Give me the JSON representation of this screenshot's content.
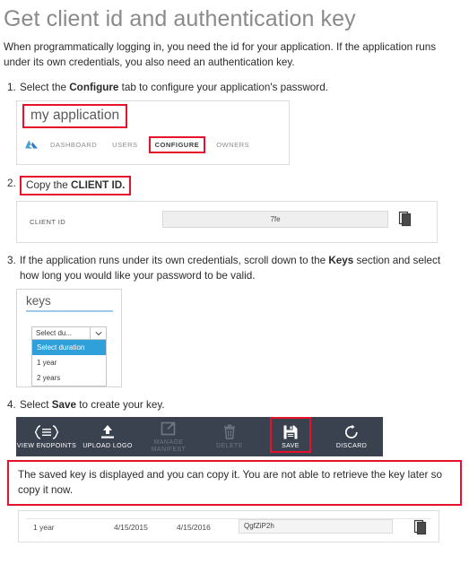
{
  "page": {
    "title": "Get client id and authentication key",
    "intro": "When programmatically logging in, you need the id for your application. If the application runs under its own credentials, you also need an authentication key."
  },
  "steps": [
    {
      "number": "1.",
      "text_before": "Select the ",
      "bold": "Configure",
      "text_after": " tab to configure your application's password."
    },
    {
      "number": "2.",
      "text_before": "Copy the ",
      "bold": "CLIENT ID.",
      "text_after": ""
    },
    {
      "number": "3.",
      "text_before": "If the application runs under its own credentials, scroll down to the ",
      "bold": "Keys",
      "text_after": " section and select how long you would like your password to be valid."
    },
    {
      "number": "4.",
      "text_before": "Select ",
      "bold": "Save",
      "text_after": " to create your key."
    }
  ],
  "app_panel": {
    "app_name": "my application",
    "icon": "azure-ad-icon",
    "tabs": [
      {
        "label": "DASHBOARD",
        "active": false
      },
      {
        "label": "USERS",
        "active": false
      },
      {
        "label": "CONFIGURE",
        "active": true
      },
      {
        "label": "OWNERS",
        "active": false
      }
    ]
  },
  "client_id_panel": {
    "label": "CLIENT ID",
    "value": "7fe",
    "copy_icon": "copy-icon"
  },
  "keys_panel": {
    "title": "keys",
    "dropdown": {
      "selected_label": "Select du...",
      "arrow_icon": "chevron-down-icon",
      "options": [
        {
          "label": "Select duration",
          "selected": true
        },
        {
          "label": "1 year",
          "selected": false
        },
        {
          "label": "2 years",
          "selected": false
        }
      ]
    }
  },
  "command_bar": {
    "items": [
      {
        "label": "VIEW ENDPOINTS",
        "icon": "view-endpoints-icon",
        "disabled": false,
        "highlighted": false
      },
      {
        "label": "UPLOAD LOGO",
        "icon": "upload-logo-icon",
        "disabled": false,
        "highlighted": false
      },
      {
        "label": "MANAGE MANIFEST",
        "icon": "manage-manifest-icon",
        "disabled": true,
        "highlighted": false
      },
      {
        "label": "DELETE",
        "icon": "trash-icon",
        "disabled": true,
        "highlighted": false
      },
      {
        "label": "SAVE",
        "icon": "save-icon",
        "disabled": false,
        "highlighted": true
      },
      {
        "label": "DISCARD",
        "icon": "discard-icon",
        "disabled": false,
        "highlighted": false
      }
    ]
  },
  "note": {
    "text": "The saved key is displayed and you can copy it. You are not able to retrieve the key later so copy it now."
  },
  "saved_key_row": {
    "duration": "1 year",
    "created": "4/15/2015",
    "expires": "4/15/2016",
    "key_value": "QgfZiP2h",
    "copy_icon": "copy-icon"
  },
  "colors": {
    "annotation_red": "#e8112d",
    "command_bar_bg": "#3a4250",
    "dropdown_highlight": "#2fa0da",
    "title_gray": "#8a8a8a",
    "keys_underline": "#9ec9e8"
  }
}
